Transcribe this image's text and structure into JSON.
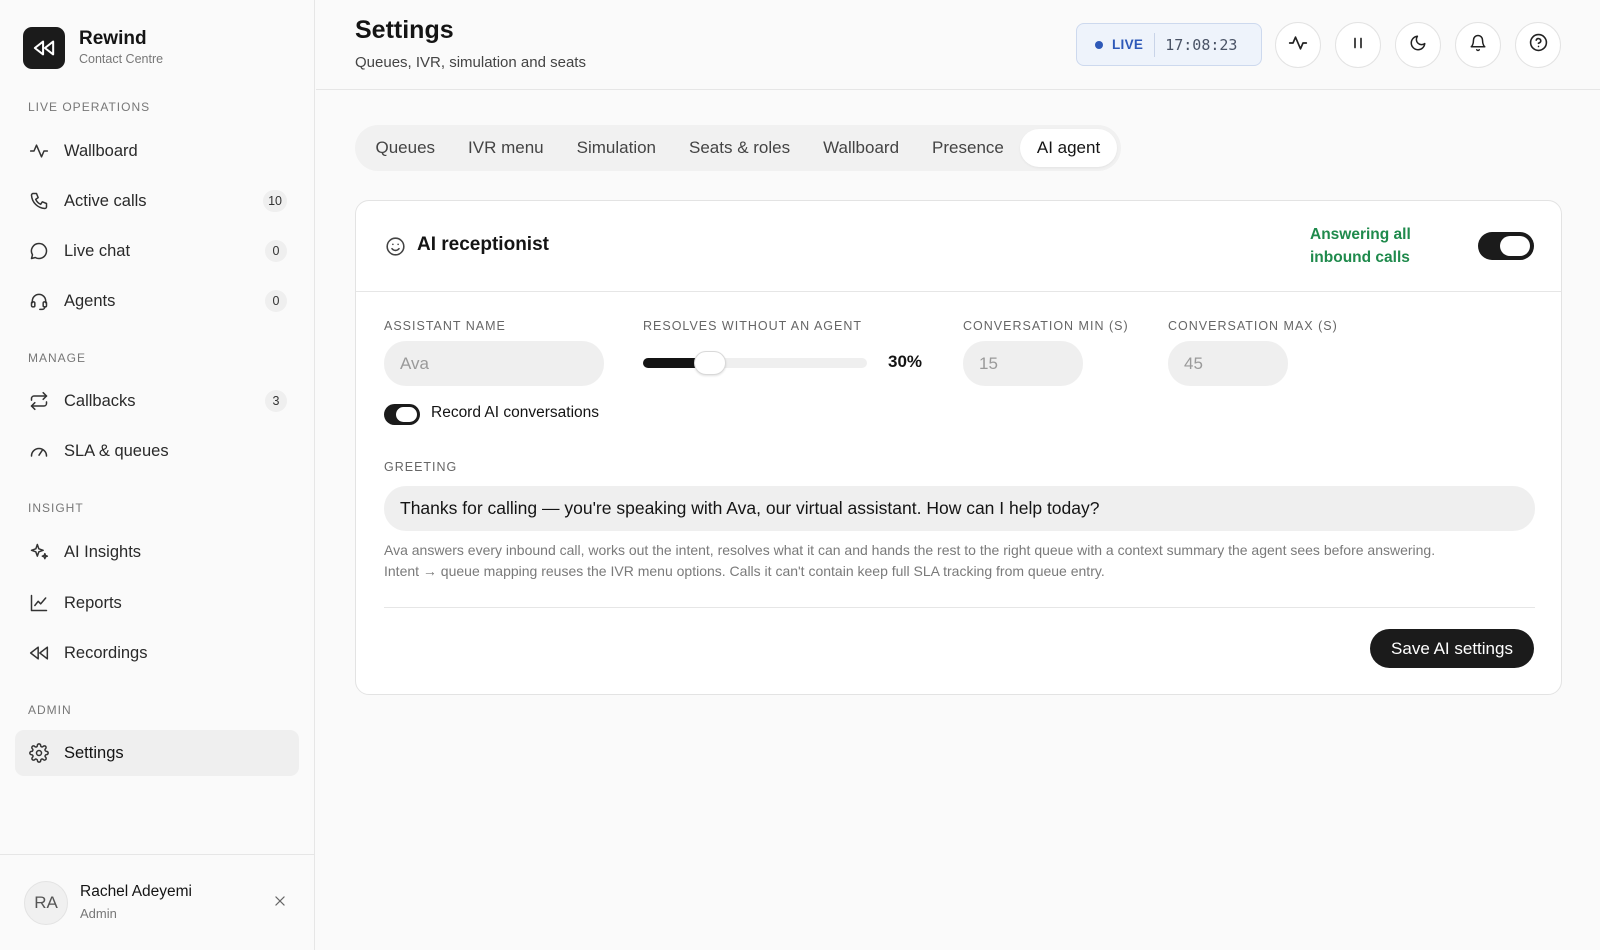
{
  "brand": {
    "name": "Rewind",
    "subtitle": "Contact Centre"
  },
  "sidebar": {
    "sections": [
      {
        "label": "Live operations"
      },
      {
        "label": "Manage"
      },
      {
        "label": "Insight"
      },
      {
        "label": "Admin"
      }
    ],
    "items": [
      {
        "label": "Wallboard",
        "icon": "activity-icon"
      },
      {
        "label": "Active calls",
        "icon": "phone-icon",
        "count": "10"
      },
      {
        "label": "Live chat",
        "icon": "chat-bubble-icon",
        "count": "0"
      },
      {
        "label": "Agents",
        "icon": "headset-icon",
        "count": "0"
      },
      {
        "label": "Callbacks",
        "icon": "repeat-icon",
        "count": "3"
      },
      {
        "label": "SLA & queues",
        "icon": "gauge-icon"
      },
      {
        "label": "AI Insights",
        "icon": "sparkles-icon"
      },
      {
        "label": "Reports",
        "icon": "line-chart-icon"
      },
      {
        "label": "Recordings",
        "icon": "rewind-icon"
      },
      {
        "label": "Settings",
        "icon": "gear-icon",
        "active": true
      }
    ]
  },
  "user": {
    "initials": "RA",
    "name": "Rachel Adeyemi",
    "role": "Admin"
  },
  "header": {
    "title": "Settings",
    "subtitle": "Queues, IVR, simulation and seats",
    "live_label": "LIVE",
    "clock": "17:08:23",
    "live_color": "#2e59b8"
  },
  "tabs": [
    {
      "label": "Queues"
    },
    {
      "label": "IVR menu"
    },
    {
      "label": "Simulation"
    },
    {
      "label": "Seats & roles"
    },
    {
      "label": "Wallboard"
    },
    {
      "label": "Presence"
    },
    {
      "label": "AI agent",
      "active": true
    }
  ],
  "ai_card": {
    "title": "AI receptionist",
    "status_text": "Answering all inbound calls",
    "status_color": "#1f8a4c",
    "enabled": true,
    "assistant_name_label": "Assistant name",
    "assistant_name_placeholder": "Ava",
    "resolves_label": "Resolves without an agent",
    "resolves_value": "30%",
    "resolves_fraction": 0.3,
    "conv_min_label": "Conversation min (s)",
    "conv_min_placeholder": "15",
    "conv_max_label": "Conversation max (s)",
    "conv_max_placeholder": "45",
    "record_label": "Record AI conversations",
    "record_enabled": true,
    "greeting_label": "Greeting",
    "greeting_value": "Thanks for calling — you're speaking with Ava, our virtual assistant. How can I help today?",
    "help_line1": "Ava answers every inbound call, works out the intent, resolves what it can and hands the rest to the right queue with a context summary the agent sees before answering.",
    "help_line2": "Intent → queue mapping reuses the IVR menu options. Calls it can't contain keep full SLA tracking from queue entry.",
    "save_label": "Save AI settings"
  }
}
